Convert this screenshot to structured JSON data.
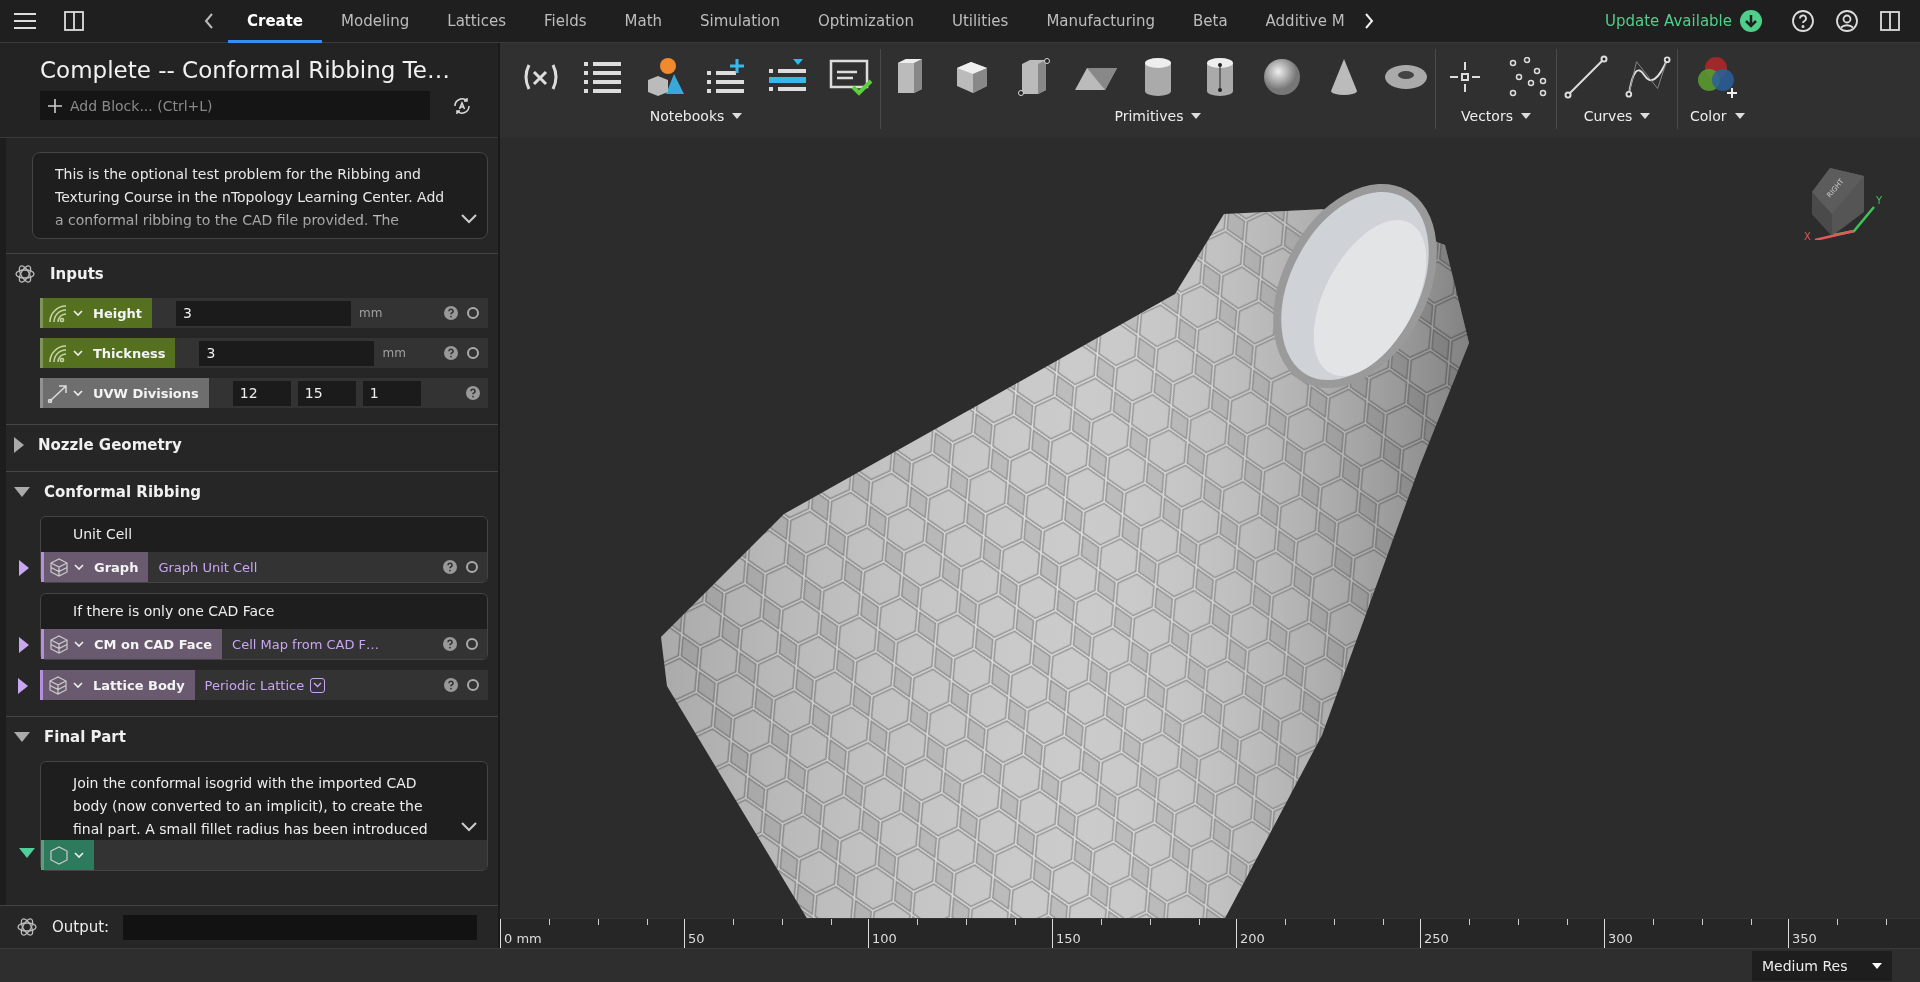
{
  "menu_tabs": [
    {
      "label": "Create",
      "selected": true
    },
    {
      "label": "Modeling",
      "selected": false
    },
    {
      "label": "Lattices",
      "selected": false
    },
    {
      "label": "Fields",
      "selected": false
    },
    {
      "label": "Math",
      "selected": false
    },
    {
      "label": "Simulation",
      "selected": false
    },
    {
      "label": "Optimization",
      "selected": false
    },
    {
      "label": "Utilities",
      "selected": false
    },
    {
      "label": "Manufacturing",
      "selected": false
    },
    {
      "label": "Beta",
      "selected": false
    },
    {
      "label": "Additive M",
      "selected": false
    }
  ],
  "update": {
    "label": "Update Available"
  },
  "notebook": {
    "title": "Complete -- Conformal Ribbing Te…",
    "add_block": {
      "placeholder": "Add Block... (Ctrl+L)"
    }
  },
  "description": {
    "text": "This is the optional test problem for the Ribbing and Texturing Course in the nTopology Learning Center. Add a conformal ribbing to the CAD file provided. The"
  },
  "sections": [
    {
      "kind": "inputs",
      "title": "Inputs",
      "cards": [
        {
          "blocks": [
            {
              "kind": "scalar_input",
              "label": "Height",
              "values": [
                "3"
              ],
              "unit": "mm"
            }
          ]
        },
        {
          "blocks": [
            {
              "kind": "scalar_input",
              "label": "Thickness",
              "values": [
                "3"
              ],
              "unit": "mm"
            }
          ]
        },
        {
          "blocks": [
            {
              "kind": "vector_input",
              "label": "UVW Divisions",
              "values": [
                "12",
                "15",
                "1"
              ]
            }
          ]
        }
      ]
    },
    {
      "kind": "group",
      "title": "Nozzle Geometry",
      "expanded": false
    },
    {
      "kind": "group",
      "title": "Conformal Ribbing",
      "expanded": true,
      "cards": [
        {
          "note": "Unit Cell",
          "blocks": [
            {
              "kind": "lattice",
              "label": "Graph",
              "value": "Graph Unit Cell",
              "expanded": false
            }
          ]
        },
        {
          "note": "If there is only one CAD Face",
          "blocks": [
            {
              "kind": "lattice",
              "label": "CM on CAD Face",
              "value": "Cell Map from CAD F…",
              "expanded": false
            }
          ]
        },
        {
          "blocks": [
            {
              "kind": "lattice",
              "label": "Lattice Body",
              "value": "Periodic Lattice",
              "dropdown": true,
              "expanded": false
            }
          ]
        }
      ]
    },
    {
      "kind": "group",
      "title": "Final Part",
      "expanded": true,
      "cards": [
        {
          "note": "Join the conformal isogrid with the imported CAD body (now converted to an implicit), to create the final part. A small fillet radius has been introduced",
          "collapsible": true,
          "blocks": [
            {
              "kind": "implicit",
              "expanded": true
            }
          ]
        }
      ]
    }
  ],
  "output": {
    "label": "Output:"
  },
  "toolbar_groups": [
    {
      "kind": "notebooks",
      "label": "Notebooks"
    },
    {
      "kind": "primitives",
      "label": "Primitives"
    },
    {
      "kind": "vectors",
      "label": "Vectors"
    },
    {
      "kind": "curves",
      "label": "Curves"
    },
    {
      "kind": "color",
      "label": "Color"
    }
  ],
  "view_cube": {
    "face": "RIGHT",
    "x_axis": "X",
    "y_axis": "Y"
  },
  "ruler": {
    "labels": [
      "0 mm",
      "50",
      "100",
      "150",
      "200",
      "250",
      "300",
      "350"
    ]
  },
  "status_bar": {
    "resolution": "Medium Res"
  }
}
